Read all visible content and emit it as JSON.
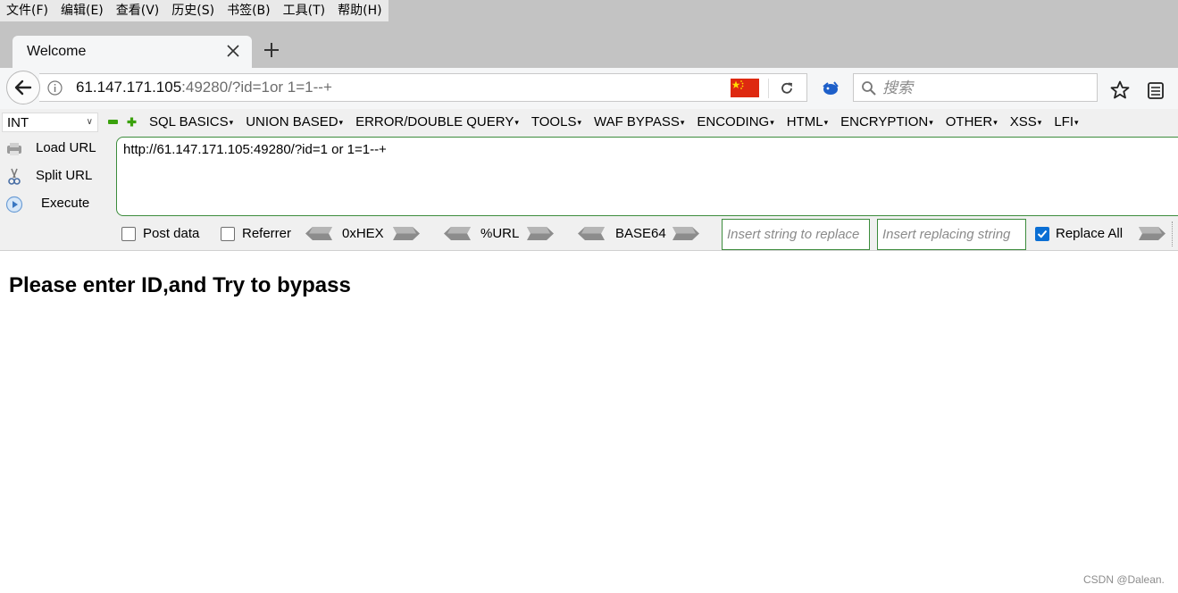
{
  "menubar": {
    "items": [
      "文件(F)",
      "编辑(E)",
      "查看(V)",
      "历史(S)",
      "书签(B)",
      "工具(T)",
      "帮助(H)"
    ]
  },
  "tab": {
    "title": "Welcome"
  },
  "urlbar": {
    "host": "61.147.171.105",
    "rest": ":49280/?id=1or 1=1--+"
  },
  "search": {
    "placeholder": "搜索"
  },
  "hackbar": {
    "type_select": "INT",
    "menus": [
      "SQL BASICS",
      "UNION BASED",
      "ERROR/DOUBLE QUERY",
      "TOOLS",
      "WAF BYPASS",
      "ENCODING",
      "HTML",
      "ENCRYPTION",
      "OTHER",
      "XSS",
      "LFI"
    ],
    "load_url": "Load URL",
    "split_url": "Split URL",
    "execute": "Execute",
    "url_value": "http://61.147.171.105:49280/?id=1 or 1=1--+",
    "post_data": "Post data",
    "referrer": "Referrer",
    "hex": "0xHEX",
    "url_enc": "%URL",
    "base64": "BASE64",
    "replace_placeholder": "Insert string to replace",
    "replacing_placeholder": "Insert replacing string",
    "replace_all": "Replace All",
    "post_data_checked": false,
    "referrer_checked": false,
    "replace_all_checked": true
  },
  "page": {
    "heading": "Please enter ID,and Try to bypass",
    "watermark": "CSDN @Dalean."
  },
  "colors": {
    "flag": "#de2910",
    "hackbar_border": "#3c8c3c",
    "checkbox_checked": "#0b6fd4"
  }
}
